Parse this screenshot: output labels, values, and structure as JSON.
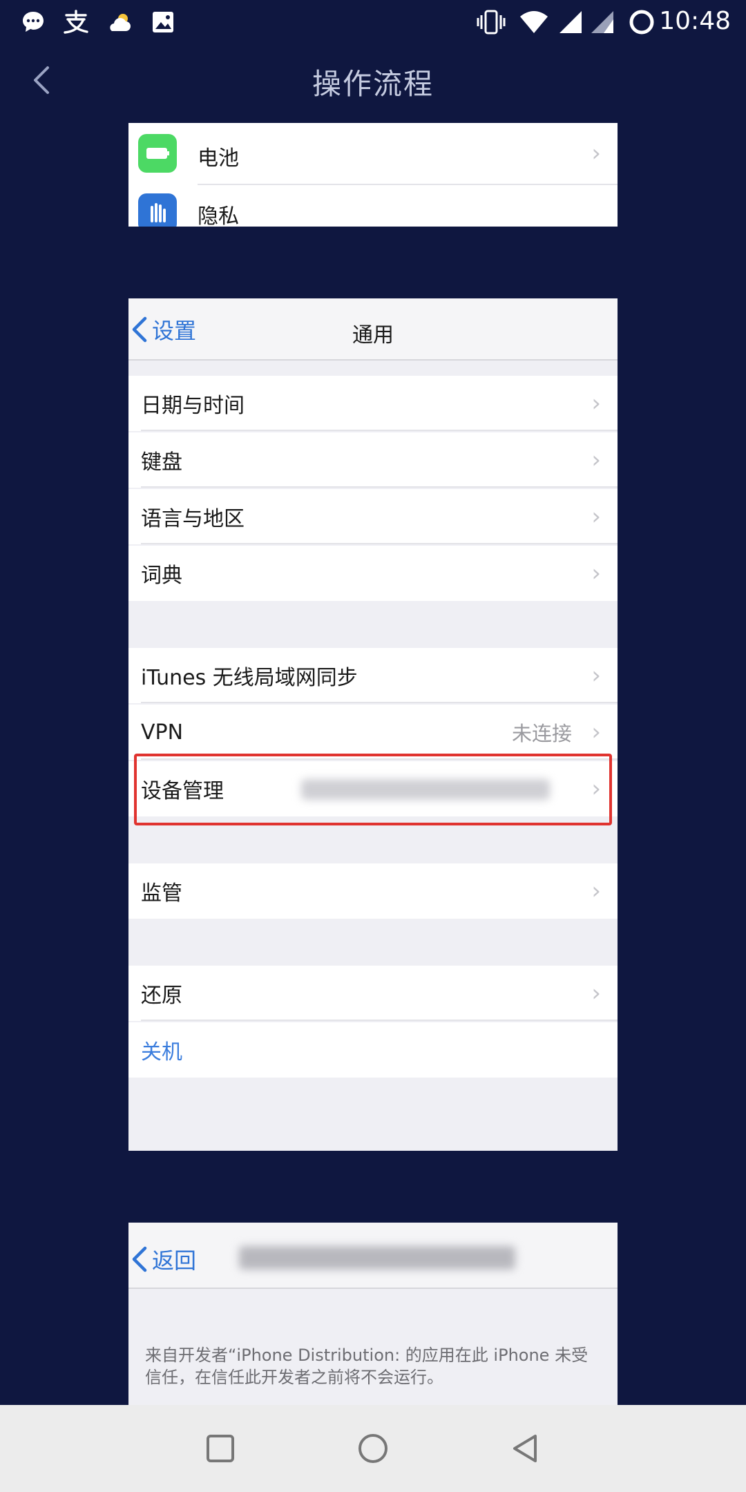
{
  "status_bar": {
    "time": "10:48",
    "icons": [
      "message-icon",
      "alipay-icon",
      "weather-icon",
      "image-icon",
      "vibrate-icon",
      "wifi-icon",
      "signal-icon",
      "signal-icon-2",
      "battery-ring-icon"
    ]
  },
  "header": {
    "title": "操作流程"
  },
  "card1": {
    "rows": [
      {
        "label": "电池",
        "icon_color": "#4cd964"
      },
      {
        "label": "隐私",
        "icon_color": "#2f74d6"
      }
    ]
  },
  "card2": {
    "nav": {
      "back_label": "设置",
      "title": "通用"
    },
    "rows": [
      {
        "label": "日期与时间"
      },
      {
        "label": "键盘"
      },
      {
        "label": "语言与地区"
      },
      {
        "label": "词典"
      },
      {
        "label": "iTunes 无线局域网同步"
      },
      {
        "label": "VPN",
        "value": "未连接"
      },
      {
        "label": "设备管理"
      },
      {
        "label": "监管"
      },
      {
        "label": "还原"
      },
      {
        "label": "关机"
      }
    ]
  },
  "card3": {
    "nav": {
      "back_label": "返回"
    },
    "description": "来自开发者“iPhone Distribution:                    的应用在此 iPhone 未受信任，在信任此开发者之前将不会运行。"
  },
  "colors": {
    "background": "#0f1740",
    "highlight": "#e0332f",
    "ios_blue": "#2f74d6"
  }
}
